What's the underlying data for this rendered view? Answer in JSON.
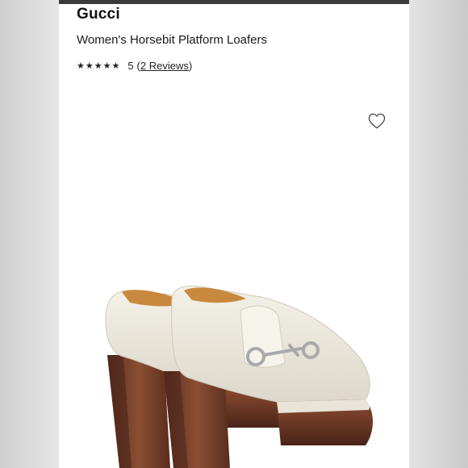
{
  "product": {
    "brand": "Gucci",
    "title": "Women's Horsebit Platform Loafers",
    "rating": {
      "stars": "★★★★★",
      "score": "5",
      "open_paren": "(",
      "reviews_label": "2 Reviews",
      "close_paren": ")"
    }
  },
  "icons": {
    "favorite": "heart-outline-icon",
    "rating": "star-icon"
  },
  "colors": {
    "text": "#111111",
    "leather": "#ede9de",
    "heel_wood": "#6b3826",
    "hardware": "#b9b9b9"
  }
}
